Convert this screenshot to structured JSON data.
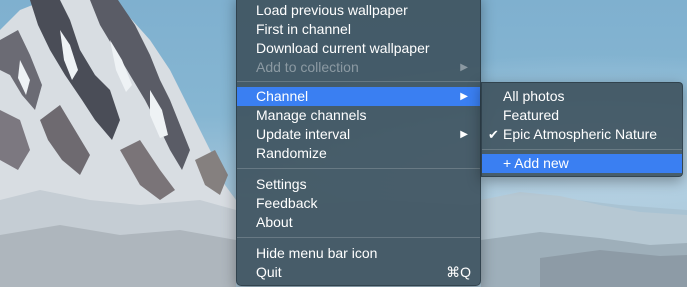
{
  "menu": {
    "items": [
      {
        "label": "Load previous wallpaper"
      },
      {
        "label": "First in channel"
      },
      {
        "label": "Download current wallpaper"
      },
      {
        "label": "Add to collection",
        "arrow": "▶"
      },
      {
        "label": "Channel",
        "arrow": "▶"
      },
      {
        "label": "Manage channels"
      },
      {
        "label": "Update interval",
        "arrow": "▶"
      },
      {
        "label": "Randomize"
      },
      {
        "label": "Settings"
      },
      {
        "label": "Feedback"
      },
      {
        "label": "About"
      },
      {
        "label": "Hide menu bar icon"
      },
      {
        "label": "Quit",
        "shortcut": "⌘Q"
      }
    ]
  },
  "submenu": {
    "items": [
      {
        "label": "All photos"
      },
      {
        "label": "Featured"
      },
      {
        "label": "Epic Atmospheric Nature",
        "check": "✔"
      },
      {
        "label": "+ Add new"
      }
    ]
  },
  "colors": {
    "highlight": "#3a7ff2",
    "menu_bg": "#3f5460"
  }
}
